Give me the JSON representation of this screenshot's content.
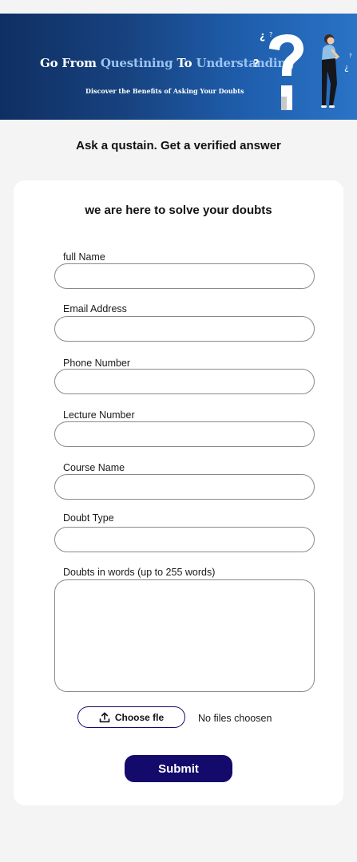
{
  "banner": {
    "title_part1": "Go From ",
    "title_accent1": "Questining",
    "title_part2": " To ",
    "title_accent2": "Understanding",
    "subtitle": "Discover the Benefits of Asking Your Doubts",
    "illustration": "question-mark-person-illustration"
  },
  "page_heading": "Ask a qustain. Get a verified answer",
  "form": {
    "heading": "we are here to solve your doubts",
    "fields": {
      "full_name": {
        "label": "full Name",
        "value": ""
      },
      "email": {
        "label": "Email Address",
        "value": ""
      },
      "phone": {
        "label": "Phone Number",
        "value": ""
      },
      "lecture": {
        "label": "Lecture Number",
        "value": ""
      },
      "course": {
        "label": "Course Name",
        "value": ""
      },
      "doubt_type": {
        "label": "Doubt Type",
        "value": ""
      },
      "doubt_words": {
        "label": "Doubts in words (up to 255 words)",
        "value": ""
      }
    },
    "file": {
      "button_label": "Choose fle",
      "icon": "upload-icon",
      "status": "No files choosen"
    },
    "submit_label": "Submit"
  },
  "colors": {
    "banner_dark": "#0f2f63",
    "banner_light": "#2a73c6",
    "title_accent": "#9cc4f2",
    "submit": "#140a6b",
    "page_bg": "#f4f4f4",
    "card_bg": "#ffffff"
  }
}
